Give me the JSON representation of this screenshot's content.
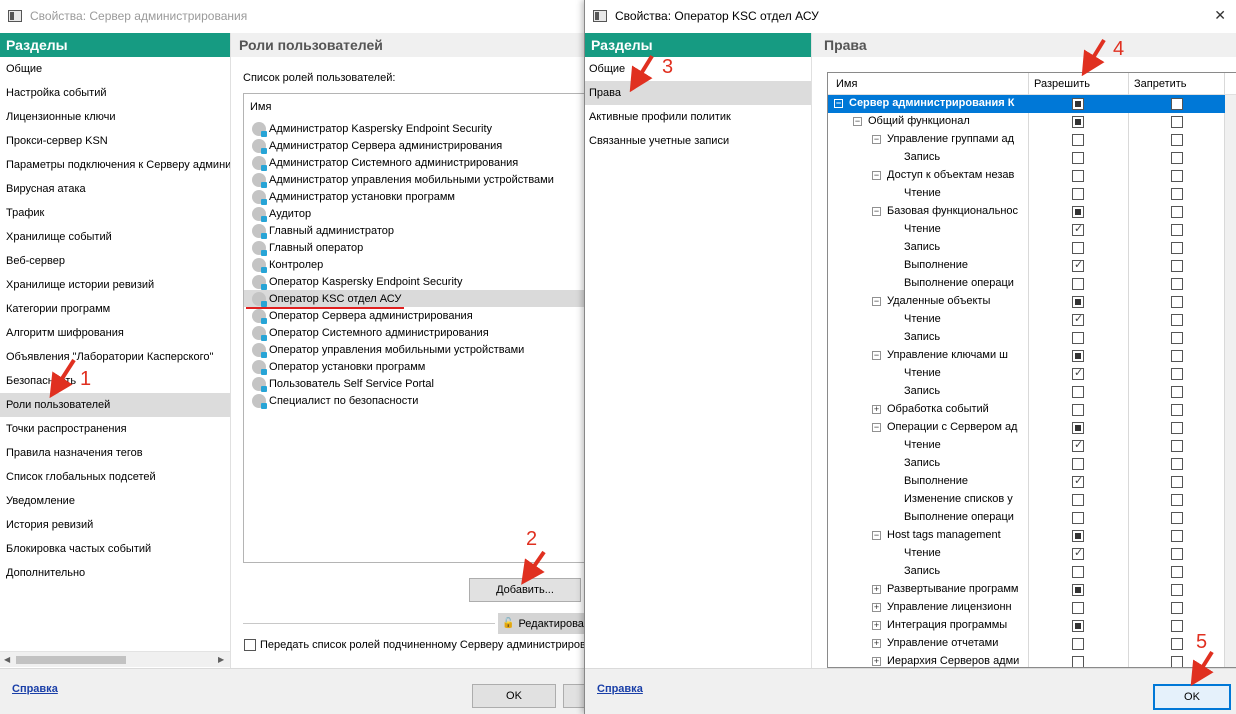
{
  "back_window": {
    "title": "Свойства: Сервер администрирования",
    "sections_header": "Разделы",
    "nav_items": [
      "Общие",
      "Настройка событий",
      "Лицензионные ключи",
      "Прокси-сервер KSN",
      "Параметры подключения к Серверу админи",
      "Вирусная атака",
      "Трафик",
      "Хранилище событий",
      "Веб-сервер",
      "Хранилище истории ревизий",
      "Категории программ",
      "Алгоритм шифрования",
      "Объявления \"Лаборатории Касперского\"",
      "Безопасность",
      "Роли пользователей",
      "Точки распространения",
      "Правила назначения тегов",
      "Список глобальных подсетей",
      "Уведомление",
      "История ревизий",
      "Блокировка частых событий",
      "Дополнительно"
    ],
    "selected_nav": "Роли пользователей",
    "panel_title": "Роли пользователей",
    "roles_label": "Список ролей пользователей:",
    "roles_column": "Имя",
    "roles": [
      "Администратор Kaspersky Endpoint Security",
      "Администратор Сервера администрирования",
      "Администратор Системного администрирования",
      "Администратор управления мобильными устройствами",
      "Администратор установки программ",
      "Аудитор",
      "Главный администратор",
      "Главный оператор",
      "Контролер",
      "Оператор Kaspersky Endpoint Security",
      "Оператор KSC отдел АСУ",
      "Оператор Сервера администрирования",
      "Оператор Системного администрирования",
      "Оператор управления мобильными устройствами",
      "Оператор установки программ",
      "Пользователь Self Service Portal",
      "Специалист по безопасности"
    ],
    "selected_role": "Оператор KSC отдел АСУ",
    "add_button": "Добавить...",
    "edit_button": "Редактирова",
    "pass_checkbox_label": "Передать список ролей подчиненному Серверу администрирова",
    "help_link": "Справка",
    "ok_button": "OK"
  },
  "front_window": {
    "title": "Свойства: Оператор KSC отдел АСУ",
    "sections_header": "Разделы",
    "nav_items": [
      "Общие",
      "Права",
      "Активные профили политик",
      "Связанные учетные записи"
    ],
    "selected_nav": "Права",
    "panel_title": "Права",
    "columns": {
      "name": "Имя",
      "allow": "Разрешить",
      "deny": "Запретить"
    },
    "rows": [
      {
        "name": "Сервер администрирования К",
        "level": 0,
        "expander": "minus",
        "allow": "partial",
        "deny": "empty",
        "selected": true
      },
      {
        "name": "Общий функционал",
        "level": 1,
        "expander": "minus",
        "allow": "partial",
        "deny": "empty"
      },
      {
        "name": "Управление группами ад",
        "level": 2,
        "expander": "minus",
        "allow": "empty",
        "deny": "empty"
      },
      {
        "name": "Запись",
        "level": 3,
        "expander": "",
        "allow": "empty",
        "deny": "empty"
      },
      {
        "name": "Доступ к объектам незав",
        "level": 2,
        "expander": "minus",
        "allow": "empty",
        "deny": "empty"
      },
      {
        "name": "Чтение",
        "level": 3,
        "expander": "",
        "allow": "empty",
        "deny": "empty"
      },
      {
        "name": "Базовая функциональнос",
        "level": 2,
        "expander": "minus",
        "allow": "partial",
        "deny": "empty"
      },
      {
        "name": "Чтение",
        "level": 3,
        "expander": "",
        "allow": "checked",
        "deny": "empty"
      },
      {
        "name": "Запись",
        "level": 3,
        "expander": "",
        "allow": "empty",
        "deny": "empty"
      },
      {
        "name": "Выполнение",
        "level": 3,
        "expander": "",
        "allow": "checked",
        "deny": "empty"
      },
      {
        "name": "Выполнение операци",
        "level": 3,
        "expander": "",
        "allow": "empty",
        "deny": "empty"
      },
      {
        "name": "Удаленные объекты",
        "level": 2,
        "expander": "minus",
        "allow": "partial",
        "deny": "empty"
      },
      {
        "name": "Чтение",
        "level": 3,
        "expander": "",
        "allow": "checked",
        "deny": "empty"
      },
      {
        "name": "Запись",
        "level": 3,
        "expander": "",
        "allow": "empty",
        "deny": "empty"
      },
      {
        "name": "Управление ключами ш",
        "level": 2,
        "expander": "minus",
        "allow": "partial",
        "deny": "empty"
      },
      {
        "name": "Чтение",
        "level": 3,
        "expander": "",
        "allow": "checked",
        "deny": "empty"
      },
      {
        "name": "Запись",
        "level": 3,
        "expander": "",
        "allow": "empty",
        "deny": "empty"
      },
      {
        "name": "Обработка событий",
        "level": 2,
        "expander": "plus",
        "allow": "empty",
        "deny": "empty"
      },
      {
        "name": "Операции с Сервером ад",
        "level": 2,
        "expander": "minus",
        "allow": "partial",
        "deny": "empty"
      },
      {
        "name": "Чтение",
        "level": 3,
        "expander": "",
        "allow": "checked",
        "deny": "empty"
      },
      {
        "name": "Запись",
        "level": 3,
        "expander": "",
        "allow": "empty",
        "deny": "empty"
      },
      {
        "name": "Выполнение",
        "level": 3,
        "expander": "",
        "allow": "checked",
        "deny": "empty"
      },
      {
        "name": "Изменение списков у",
        "level": 3,
        "expander": "",
        "allow": "empty",
        "deny": "empty"
      },
      {
        "name": "Выполнение операци",
        "level": 3,
        "expander": "",
        "allow": "empty",
        "deny": "empty"
      },
      {
        "name": "Host tags management",
        "level": 2,
        "expander": "minus",
        "allow": "partial",
        "deny": "empty"
      },
      {
        "name": "Чтение",
        "level": 3,
        "expander": "",
        "allow": "checked",
        "deny": "empty"
      },
      {
        "name": "Запись",
        "level": 3,
        "expander": "",
        "allow": "empty",
        "deny": "empty"
      },
      {
        "name": "Развертывание программ",
        "level": 2,
        "expander": "plus",
        "allow": "partial",
        "deny": "empty"
      },
      {
        "name": "Управление лицензионн",
        "level": 2,
        "expander": "plus",
        "allow": "empty",
        "deny": "empty"
      },
      {
        "name": "Интеграция программы",
        "level": 2,
        "expander": "plus",
        "allow": "partial",
        "deny": "empty"
      },
      {
        "name": "Управление отчетами",
        "level": 2,
        "expander": "plus",
        "allow": "empty",
        "deny": "empty"
      },
      {
        "name": "Иерархия Серверов адми",
        "level": 2,
        "expander": "plus",
        "allow": "empty",
        "deny": "empty"
      }
    ],
    "help_link": "Справка",
    "ok_button": "OK"
  },
  "annotations": [
    "1",
    "2",
    "3",
    "4",
    "5"
  ],
  "colors": {
    "accent_green": "#169b82",
    "selection_blue": "#0078d7",
    "annotation_red": "#e03020",
    "link_blue": "#1a3fa8"
  }
}
